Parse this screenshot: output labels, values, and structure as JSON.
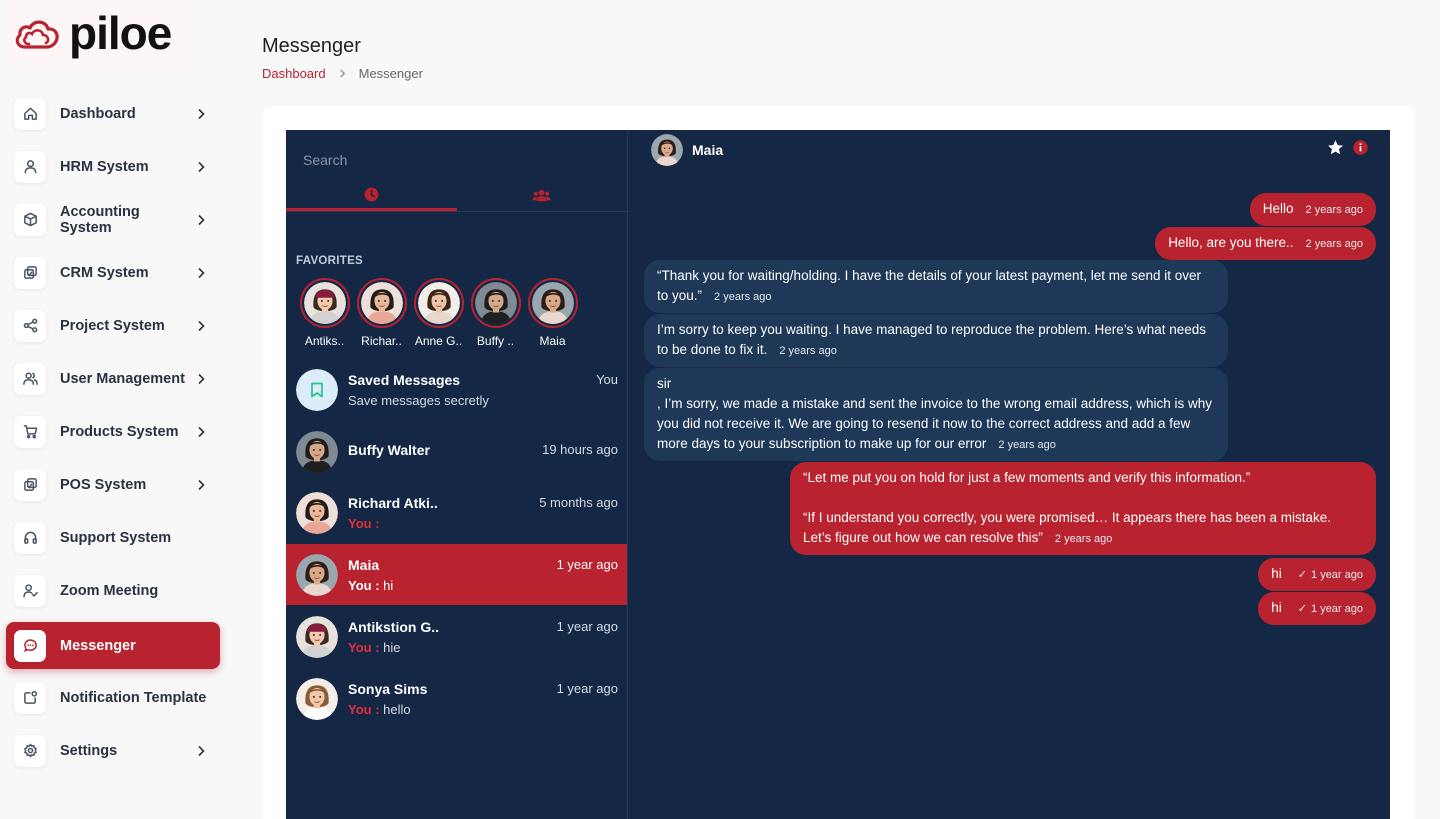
{
  "brand": {
    "name": "piloe",
    "accent": "#b8232f"
  },
  "sidebar": {
    "items": [
      {
        "label": "Dashboard",
        "icon": "home-icon",
        "chevron": true
      },
      {
        "label": " HRM System",
        "icon": "user-icon",
        "chevron": true
      },
      {
        "label": "Accounting System",
        "icon": "box-icon",
        "chevron": true
      },
      {
        "label": "CRM System",
        "icon": "layers-icon",
        "chevron": true
      },
      {
        "label": "Project System",
        "icon": "share-icon",
        "chevron": true
      },
      {
        "label": "User Management",
        "icon": "users-icon",
        "chevron": true
      },
      {
        "label": "Products System",
        "icon": "cart-icon",
        "chevron": true
      },
      {
        "label": "POS System",
        "icon": "layers-icon",
        "chevron": true
      },
      {
        "label": "Support System",
        "icon": "headphones-icon",
        "chevron": false
      },
      {
        "label": "Zoom Meeting",
        "icon": "user-check-icon",
        "chevron": false
      },
      {
        "label": "Messenger",
        "icon": "message-icon",
        "chevron": false,
        "active": true
      },
      {
        "label": "Notification Template",
        "icon": "notification-icon",
        "chevron": false
      },
      {
        "label": "Settings",
        "icon": "gear-icon",
        "chevron": true
      }
    ]
  },
  "header": {
    "title": "Messenger",
    "breadcrumb": {
      "home": "Dashboard",
      "current": "Messenger"
    }
  },
  "messenger": {
    "search_placeholder": "Search",
    "favorites_title": "FAVORITES",
    "favorites": [
      "Antiks..",
      "Richar..",
      "Anne G..",
      "Buffy ..",
      "Maia"
    ],
    "saved": {
      "name": "Saved Messages",
      "sub": "Save messages secretly",
      "tag": "You"
    },
    "contacts": [
      {
        "name": "Buffy Walter",
        "time": "19 hours ago",
        "you": "",
        "text": ""
      },
      {
        "name": "Richard Atki..",
        "time": "5 months ago",
        "you": "You :",
        "text": ""
      },
      {
        "name": "Maia",
        "time": "1 year ago",
        "you": "You :",
        "text": " hi",
        "active": true
      },
      {
        "name": "Antikstion G..",
        "time": "1 year ago",
        "you": "You :",
        "text": " hie"
      },
      {
        "name": "Sonya Sims",
        "time": "1 year ago",
        "you": "You :",
        "text": " hello"
      }
    ],
    "conversation": {
      "name": "Maia",
      "messages": [
        {
          "dir": "out",
          "text": "Hello",
          "time": "2 years ago"
        },
        {
          "dir": "out",
          "text": "Hello, are you there..",
          "time": "2 years ago"
        },
        {
          "dir": "in",
          "text": "“Thank you for waiting/holding. I have the details of your latest payment, let me send it over to you.”",
          "time": "2 years ago"
        },
        {
          "dir": "in",
          "text": "I’m sorry to keep you waiting. I have managed to reproduce the problem. Here’s what needs to be done to fix it.",
          "time": "2 years ago"
        },
        {
          "dir": "in",
          "text_lines": [
            "sir",
            ", I’m sorry, we made a mistake and sent the invoice to the wrong email address, which is why you did not receive it. We are going to resend it now to the correct address and add a few more days to your subscription to make up for our error"
          ],
          "time": "2 years ago"
        },
        {
          "dir": "out",
          "text_lines": [
            "“Let me put you on hold for just a few moments and verify this information.”",
            "“If I understand you correctly, you were promised… It appears there has been a mistake. Let’s figure out how we can resolve this”"
          ],
          "time": "2 years ago"
        },
        {
          "dir": "out",
          "text": "hi",
          "time": "1 year ago",
          "seen": "✓"
        },
        {
          "dir": "out",
          "text": "hi",
          "time": "1 year ago",
          "seen": "✓"
        }
      ]
    }
  }
}
